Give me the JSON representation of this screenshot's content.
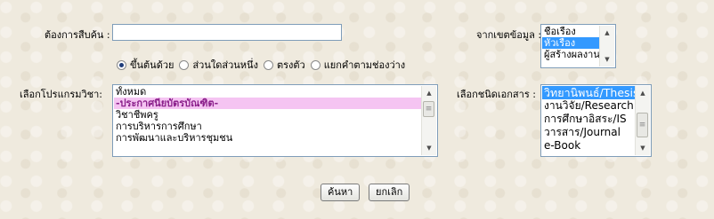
{
  "search": {
    "label": "ต้องการสืบค้น :",
    "value": "",
    "placeholder": ""
  },
  "field_select": {
    "label": "จากเขตข้อมูล :",
    "options": [
      {
        "label": "ชื่อเรื่อง",
        "selected": false
      },
      {
        "label": "หัวเรื่อง",
        "selected": true
      },
      {
        "label": "ผู้สร้างผลงาน",
        "selected": false
      }
    ]
  },
  "match_options": [
    {
      "label": "ขึ้นต้นด้วย",
      "checked": true
    },
    {
      "label": "ส่วนใดส่วนหนึ่ง",
      "checked": false
    },
    {
      "label": "ตรงตัว",
      "checked": false
    },
    {
      "label": "แยกคำตามช่องว่าง",
      "checked": false
    }
  ],
  "program_select": {
    "label": "เลือกโปรแกรมวิชา:",
    "options": [
      {
        "label": "ทั้งหมด",
        "style": "normal"
      },
      {
        "label": "-ประกาศนียบัตรบัณฑิต-",
        "style": "group"
      },
      {
        "label": "วิชาชีพครู",
        "style": "normal"
      },
      {
        "label": "การบริหารการศึกษา",
        "style": "normal"
      },
      {
        "label": "การพัฒนาและบริหารชุมชน",
        "style": "normal"
      }
    ]
  },
  "doctype_select": {
    "label": "เลือกชนิดเอกสาร :",
    "options": [
      {
        "label": "วิทยานิพนธ์/Thesis",
        "selected": true
      },
      {
        "label": "งานวิจัย/Research",
        "selected": false
      },
      {
        "label": "การศึกษาอิสระ/IS",
        "selected": false
      },
      {
        "label": "วารสาร/Journal",
        "selected": false
      },
      {
        "label": "e-Book",
        "selected": false
      }
    ]
  },
  "buttons": {
    "search": "ค้นหา",
    "cancel": "ยกเลิก"
  },
  "colors": {
    "selection": "#3399ff",
    "group_highlight": "#f5c4f2",
    "background": "#efeade"
  }
}
